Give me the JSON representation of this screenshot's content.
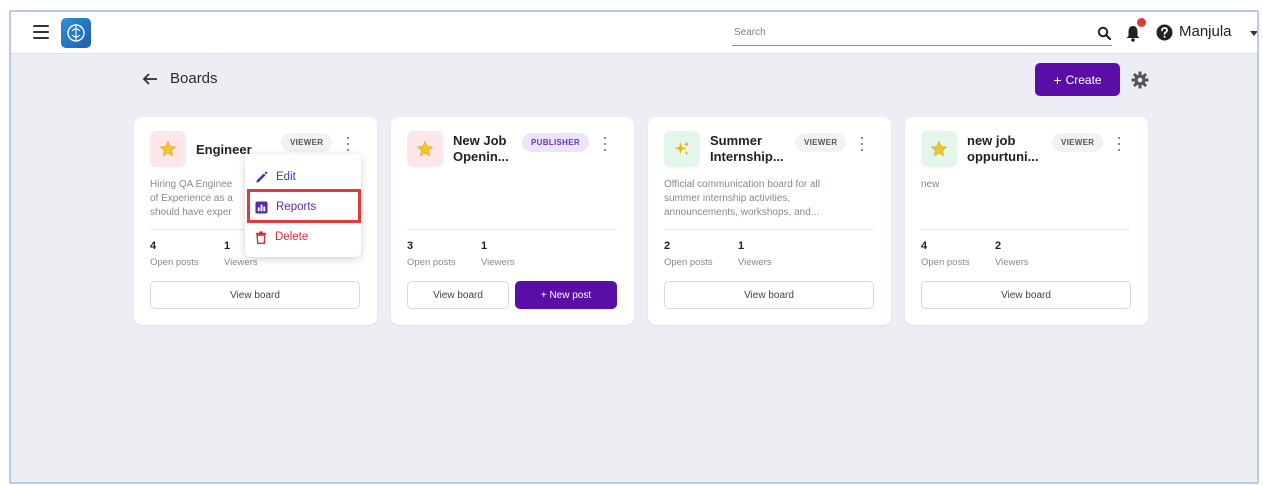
{
  "header": {
    "search_placeholder": "Search",
    "user_name": "Manjula"
  },
  "page": {
    "title": "Boards",
    "create_label": "Create"
  },
  "cards": [
    {
      "title": "Engineer",
      "role": "VIEWER",
      "description": "Hiring QA Engineer ... of Experience as a ... should have exper...",
      "desc_lines": [
        "Hiring QA Enginee",
        "of Experience as a",
        "should have exper"
      ],
      "open_posts": "4",
      "viewers": "1",
      "open_posts_label": "Open posts",
      "viewers_label": "Viewers",
      "view_label": "View board"
    },
    {
      "title_lines": [
        "New Job",
        "Openin..."
      ],
      "role": "PUBLISHER",
      "open_posts": "3",
      "viewers": "1",
      "open_posts_label": "Open posts",
      "viewers_label": "Viewers",
      "view_label": "View board",
      "new_post_label": "+ New post"
    },
    {
      "title_lines": [
        "Summer",
        "Internship..."
      ],
      "role": "VIEWER",
      "desc_lines": [
        "Official communication board for all",
        "summer internship activities,",
        "announcements, workshops, and..."
      ],
      "open_posts": "2",
      "viewers": "1",
      "open_posts_label": "Open posts",
      "viewers_label": "Viewers",
      "view_label": "View board"
    },
    {
      "title_lines": [
        "new job",
        "oppurtuni..."
      ],
      "role": "VIEWER",
      "desc_lines": [
        "new"
      ],
      "open_posts": "4",
      "viewers": "2",
      "open_posts_label": "Open posts",
      "viewers_label": "Viewers",
      "view_label": "View board"
    }
  ],
  "context_menu": {
    "edit": "Edit",
    "reports": "Reports",
    "delete": "Delete"
  },
  "colors": {
    "primary": "#5b0ea6",
    "danger": "#d32f2f",
    "highlight": "#e03b3b"
  },
  "icons": {
    "card1": "star-icon",
    "card2": "star-icon",
    "card3": "sparkle-icon",
    "card4": "star-icon"
  }
}
